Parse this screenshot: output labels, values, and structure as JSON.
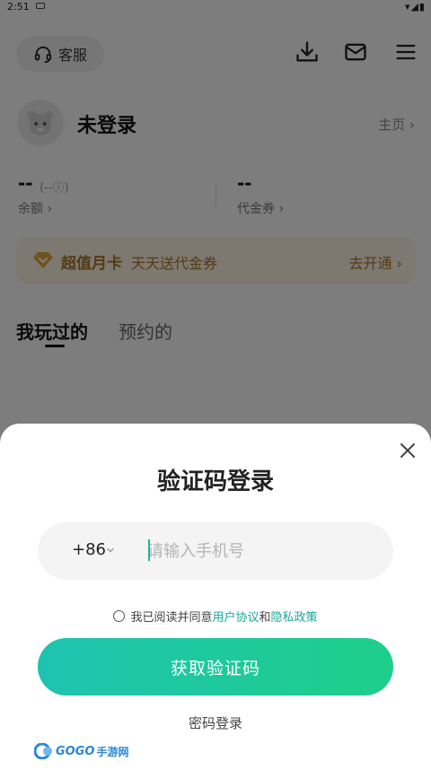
{
  "status_bar": {
    "time": "2:51",
    "system_icons": "▾◢▮"
  },
  "header": {
    "service_label": "客服",
    "icons": [
      "headset-icon",
      "download-icon",
      "mail-icon",
      "menu-icon"
    ]
  },
  "profile": {
    "username": "未登录",
    "homepage_label": "主页 ›"
  },
  "wallet": {
    "balance_value": "--",
    "balance_sub": "(--ⓘ)",
    "balance_label": "余额 ›",
    "coupon_value": "--",
    "coupon_label": "代金券 ›"
  },
  "vip_banner": {
    "title": "超值月卡",
    "desc": "天天送代金券",
    "action": "去开通 ›",
    "accent": "#a8742c"
  },
  "tabs": [
    {
      "label": "我玩过的",
      "active": true
    },
    {
      "label": "预约的",
      "active": false
    }
  ],
  "login_sheet": {
    "title": "验证码登录",
    "country_code": "+86",
    "phone_placeholder": "请输入手机号",
    "agreement_prefix": "我已阅读并同意",
    "user_agreement": "用户协议",
    "and": "和",
    "privacy_policy": "隐私政策",
    "get_code_label": "获取验证码",
    "password_login_label": "密码登录",
    "button_gradient": [
      "#1ec3b0",
      "#1ecf8a"
    ],
    "link_color": "#1aa79a"
  },
  "watermark": {
    "text_en": "GOGO",
    "text_cn": "手游网"
  }
}
